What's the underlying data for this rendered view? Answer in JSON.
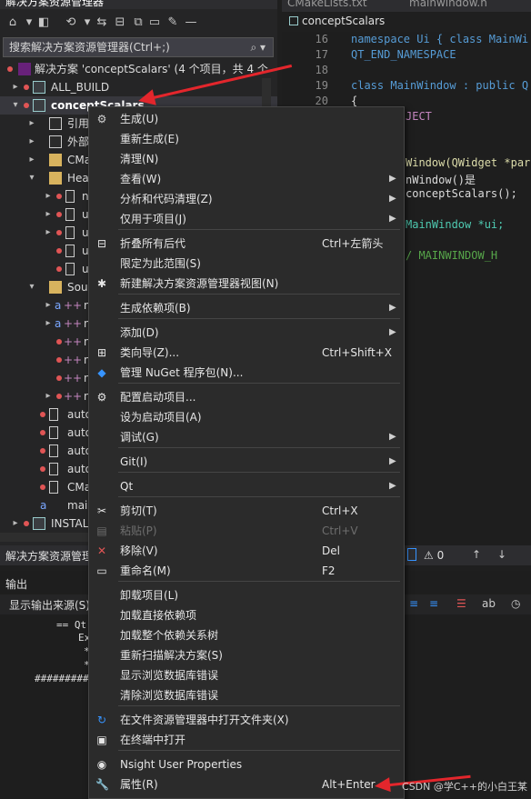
{
  "explorer": {
    "title": "解决方案资源管理器",
    "search_placeholder": "搜索解决方案资源管理器(Ctrl+;)",
    "bottom_tab": "解决方案资源管理",
    "solution_label": "解决方案 'conceptScalars' (4 个项目，共 4 个",
    "rows": {
      "all_build": "ALL_BUILD",
      "concept_scalars": "conceptScalars",
      "references": "引用",
      "external": "外部",
      "cmake": "CMa",
      "header": "Hea",
      "h1": "n",
      "h2": "u",
      "h3": "u",
      "h4": "u",
      "h5": "u",
      "source": "Sou",
      "s1": "n",
      "s2": "n",
      "s3": "n",
      "s4": "n",
      "s5": "n",
      "s6": "n",
      "auto1": "auto",
      "auto2": "auto",
      "auto3": "auto",
      "auto4": "auto",
      "cmake2": "CMa",
      "main": "mai",
      "install": "INSTAL"
    }
  },
  "editor": {
    "tabs": [
      "CMakeLists.txt",
      "mainwindow.h"
    ],
    "file_tab": "conceptScalars",
    "line_numbers": [
      "16",
      "17",
      "18",
      "19",
      "20"
    ],
    "lines": {
      "l16": "namespace Ui { class MainWi",
      "l17": "QT_END_NAMESPACE",
      "l19": "class MainWindow : public Q",
      "l20": "{",
      "l21": "JECT",
      "l23": "Window(QWidget *par",
      "l24": "nWindow()是",
      "l25": " conceptScalars();",
      "l27": "MainWindow *ui;",
      "l29": "/ MAINWINDOW_H"
    },
    "status_num": "0"
  },
  "output": {
    "title": "输出",
    "source_label": "显示输出来源(S)",
    "lines": [
      "== Qt",
      "Ex",
      "*",
      "*",
      "##########"
    ]
  },
  "menu": {
    "items": [
      {
        "label": "生成(U)",
        "shortcut": "",
        "submenu": false,
        "icon": "build-icon"
      },
      {
        "label": "重新生成(E)",
        "shortcut": "",
        "submenu": false,
        "icon": ""
      },
      {
        "label": "清理(N)",
        "shortcut": "",
        "submenu": false,
        "icon": ""
      },
      {
        "label": "查看(W)",
        "shortcut": "",
        "submenu": true,
        "icon": ""
      },
      {
        "label": "分析和代码清理(Z)",
        "shortcut": "",
        "submenu": true,
        "icon": ""
      },
      {
        "label": "仅用于项目(J)",
        "shortcut": "",
        "submenu": true,
        "icon": ""
      },
      {
        "label": "折叠所有后代",
        "shortcut": "Ctrl+左箭头",
        "submenu": false,
        "icon": "collapse-icon"
      },
      {
        "label": "限定为此范围(S)",
        "shortcut": "",
        "submenu": false,
        "icon": ""
      },
      {
        "label": "新建解决方案资源管理器视图(N)",
        "shortcut": "",
        "submenu": false,
        "icon": "new-view-icon"
      },
      {
        "label": "生成依赖项(B)",
        "shortcut": "",
        "submenu": true,
        "icon": ""
      },
      {
        "label": "添加(D)",
        "shortcut": "",
        "submenu": true,
        "icon": ""
      },
      {
        "label": "类向导(Z)...",
        "shortcut": "Ctrl+Shift+X",
        "submenu": false,
        "icon": "class-wizard-icon"
      },
      {
        "label": "管理 NuGet 程序包(N)...",
        "shortcut": "",
        "submenu": false,
        "icon": "nuget-icon"
      },
      {
        "label": "配置启动项目...",
        "shortcut": "",
        "submenu": false,
        "icon": "gear-icon"
      },
      {
        "label": "设为启动项目(A)",
        "shortcut": "",
        "submenu": false,
        "icon": ""
      },
      {
        "label": "调试(G)",
        "shortcut": "",
        "submenu": true,
        "icon": ""
      },
      {
        "label": "Git(I)",
        "shortcut": "",
        "submenu": true,
        "icon": ""
      },
      {
        "label": "Qt",
        "shortcut": "",
        "submenu": true,
        "icon": ""
      },
      {
        "label": "剪切(T)",
        "shortcut": "Ctrl+X",
        "submenu": false,
        "icon": "scissors-icon"
      },
      {
        "label": "粘贴(P)",
        "shortcut": "Ctrl+V",
        "submenu": false,
        "icon": "paste-icon"
      },
      {
        "label": "移除(V)",
        "shortcut": "Del",
        "submenu": false,
        "icon": "remove-icon"
      },
      {
        "label": "重命名(M)",
        "shortcut": "F2",
        "submenu": false,
        "icon": "rename-icon"
      },
      {
        "label": "卸载项目(L)",
        "shortcut": "",
        "submenu": false,
        "icon": ""
      },
      {
        "label": "加载直接依赖项",
        "shortcut": "",
        "submenu": false,
        "icon": ""
      },
      {
        "label": "加载整个依赖关系树",
        "shortcut": "",
        "submenu": false,
        "icon": ""
      },
      {
        "label": "重新扫描解决方案(S)",
        "shortcut": "",
        "submenu": false,
        "icon": ""
      },
      {
        "label": "显示浏览数据库错误",
        "shortcut": "",
        "submenu": false,
        "icon": ""
      },
      {
        "label": "清除浏览数据库错误",
        "shortcut": "",
        "submenu": false,
        "icon": ""
      },
      {
        "label": "在文件资源管理器中打开文件夹(X)",
        "shortcut": "",
        "submenu": false,
        "icon": "open-folder-icon"
      },
      {
        "label": "在终端中打开",
        "shortcut": "",
        "submenu": false,
        "icon": "terminal-icon"
      },
      {
        "label": "Nsight User Properties",
        "shortcut": "",
        "submenu": false,
        "icon": "nsight-icon"
      },
      {
        "label": "属性(R)",
        "shortcut": "Alt+Enter",
        "submenu": false,
        "icon": "wrench-icon"
      }
    ]
  },
  "watermark": "CSDN @学C++的小白王某",
  "colors": {
    "accent": "#3794ff",
    "arrow": "#e3262c",
    "menu_bg": "#2b2b2b"
  }
}
